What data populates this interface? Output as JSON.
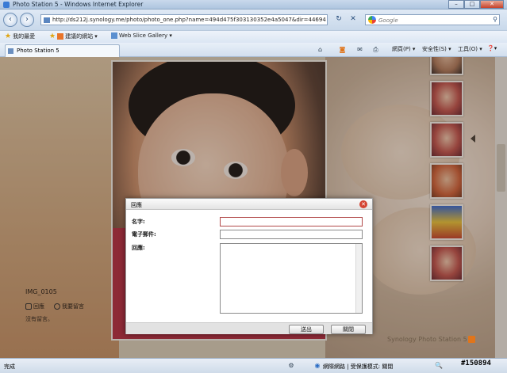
{
  "window": {
    "title": "Photo Station 5 - Windows Internet Explorer",
    "min_label": "–",
    "max_label": "□",
    "close_label": "✕"
  },
  "address_bar": {
    "back_icon": "‹",
    "forward_icon": "›",
    "url": "http://ds212j.synology.me/photo/photo_one.php?name=494d475f303130352e4a5047&dir=44694469",
    "refresh_icon": "↻",
    "stop_icon": "✕",
    "search_placeholder": "Google",
    "search_icon": "⚲"
  },
  "favorites_bar": {
    "favorites_label": "我的最愛",
    "suggested_sites_label": "建議的網站 ▾",
    "web_slice_label": "Web Slice Gallery ▾"
  },
  "tab_bar": {
    "tab_label": "Photo Station 5",
    "commands": {
      "page_label": "網頁(P) ▾",
      "safety_label": "安全性(S) ▾",
      "tools_label": "工具(O) ▾",
      "help_label": "❓▾"
    }
  },
  "page": {
    "image_name": "IMG_0105",
    "reply_action": "回應",
    "comment_action": "我要留言",
    "no_comment": "沒有留言。",
    "brand": "Synology Photo Station 5",
    "thumbnail_count": 6
  },
  "dialog": {
    "title": "回應",
    "name_label": "名字:",
    "name_value": "",
    "email_label": "電子郵件:",
    "email_value": "",
    "reply_label": "回應:",
    "reply_value": "",
    "submit_label": "送出",
    "close_label": "關閉"
  },
  "status_bar": {
    "text": "完成",
    "zone": "網際網路 | 受保護模式: 關閉",
    "zoom_icon": "🔍"
  },
  "watermark": "#150894"
}
